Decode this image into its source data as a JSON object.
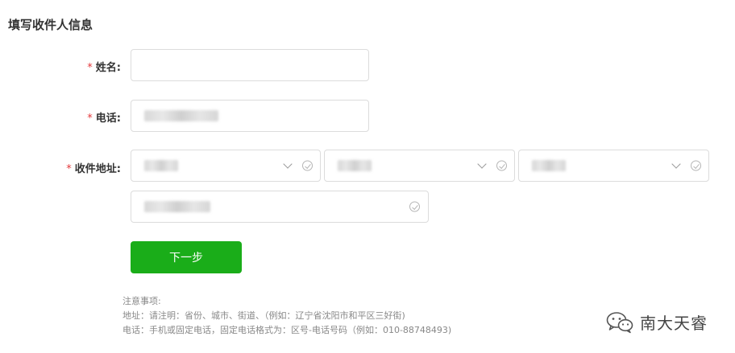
{
  "section": {
    "title": "填写收件人信息"
  },
  "form": {
    "required_mark": "*",
    "name": {
      "label": "姓名:",
      "value": ""
    },
    "phone": {
      "label": "电话:"
    },
    "address": {
      "label": "收件地址:"
    }
  },
  "actions": {
    "next_label": "下一步"
  },
  "notes": {
    "title": "注意事项:",
    "address_tip": "地址：请注明：省份、城市、街道、（例如：辽宁省沈阳市和平区三好街)",
    "phone_tip": "电话：手机或固定电话，固定电话格式为：区号-电话号码（例如：010-88748493)"
  },
  "watermark": {
    "text": "南大天睿",
    "icon": "wechat-icon"
  },
  "colors": {
    "accent": "#1aad19",
    "required": "#e4393c"
  }
}
